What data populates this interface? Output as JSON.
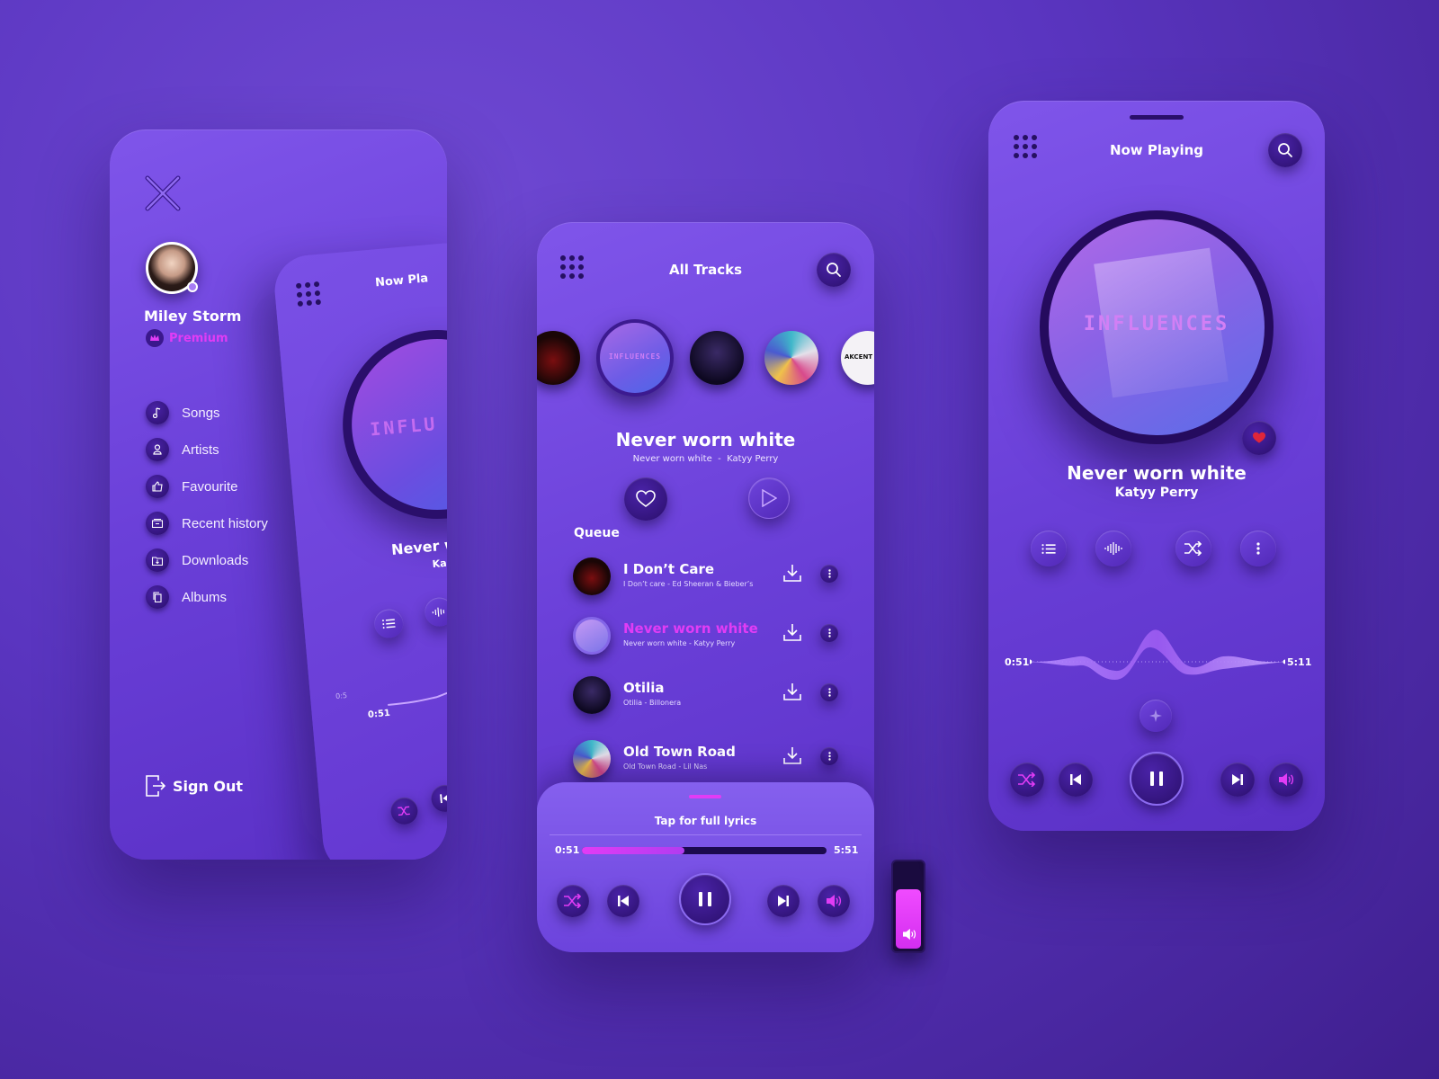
{
  "menu_screen": {
    "user_name": "Miley Storm",
    "plan_badge": "Premium",
    "items": [
      {
        "label": "Songs",
        "icon": "music-note-icon"
      },
      {
        "label": "Artists",
        "icon": "user-icon"
      },
      {
        "label": "Favourite",
        "icon": "thumbs-up-icon"
      },
      {
        "label": "Recent history",
        "icon": "history-icon"
      },
      {
        "label": "Downloads",
        "icon": "download-folder-icon"
      },
      {
        "label": "Albums",
        "icon": "album-icon"
      }
    ],
    "sign_out_label": "Sign Out",
    "behind_title": "Now Pla",
    "behind_song": "Never w",
    "behind_artist": "Ka",
    "behind_art_text": "INFLU",
    "behind_time": "0:51",
    "behind_time_2": "0:5"
  },
  "tracks_screen": {
    "header_title": "All Tracks",
    "carousel_center_text": "INFLUENCES",
    "carousel_right_text": "AKCENT",
    "current_title": "Never worn white",
    "current_sub_song": "Never worn white",
    "current_sub_artist": "Katyy Perry",
    "queue_label": "Queue",
    "queue": [
      {
        "title": "I Don’t Care",
        "subtitle": "I Don’t care - Ed Sheeran & Bieber’s",
        "active": false
      },
      {
        "title": "Never worn white",
        "subtitle": "Never worn white  -  Katyy Perry",
        "active": true
      },
      {
        "title": "Otilia",
        "subtitle": "Otilia - Billonera",
        "active": false
      },
      {
        "title": "Old Town Road",
        "subtitle": "Old Town Road - Lil Nas",
        "active": false
      }
    ],
    "lyrics_label": "Tap for full lyrics",
    "time_elapsed": "0:51",
    "time_total": "5:51",
    "progress": 0.42
  },
  "volume_slider": {
    "level": 0.72
  },
  "now_playing_screen": {
    "header_title": "Now Playing",
    "art_text": "INFLUENCES",
    "song_title": "Never worn white",
    "artist": "Katyy Perry",
    "time_elapsed": "0:51",
    "time_total": "5:11"
  },
  "colors": {
    "accent_pink": "#e13cf5",
    "dark_button": "#2a0f6b",
    "heart_red": "#e0263a"
  }
}
